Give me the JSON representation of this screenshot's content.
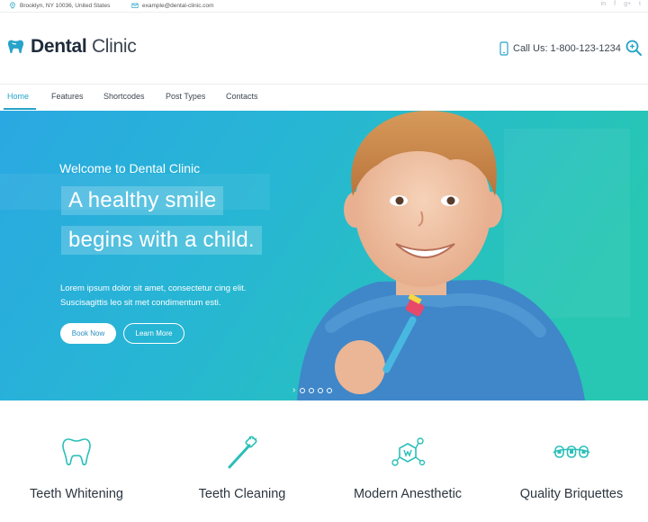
{
  "topbar": {
    "address": "Brooklyn, NY 10036, United States",
    "email": "example@dental-clinic.com",
    "socials": [
      "in",
      "f",
      "g+",
      "t"
    ]
  },
  "header": {
    "brand_bold": "Dental",
    "brand_regular": "Clinic",
    "call_text": "Call Us: 1-800-123-1234"
  },
  "nav": {
    "items": [
      "Home",
      "Features",
      "Shortcodes",
      "Post Types",
      "Contacts"
    ],
    "active": "Home"
  },
  "hero": {
    "welcome": "Welcome to Dental Clinic",
    "headline_line1": "A healthy smile",
    "headline_line2": "begins with a child.",
    "description": "Lorem ipsum dolor sit amet, consectetur cing elit. Suscisagittis leo sit met condimentum esti.",
    "book_label": "Book Now",
    "learn_label": "Learn More",
    "slider_arrow": "›"
  },
  "features": [
    {
      "label": "Teeth Whitening",
      "icon": "tooth-icon"
    },
    {
      "label": "Teeth Cleaning",
      "icon": "toothbrush-icon"
    },
    {
      "label": "Modern Anesthetic",
      "icon": "molecule-icon"
    },
    {
      "label": "Quality Briquettes",
      "icon": "braces-icon"
    }
  ],
  "colors": {
    "accent": "#27a3c9",
    "hero_start": "#29a5e0",
    "hero_end": "#28c6b4"
  }
}
